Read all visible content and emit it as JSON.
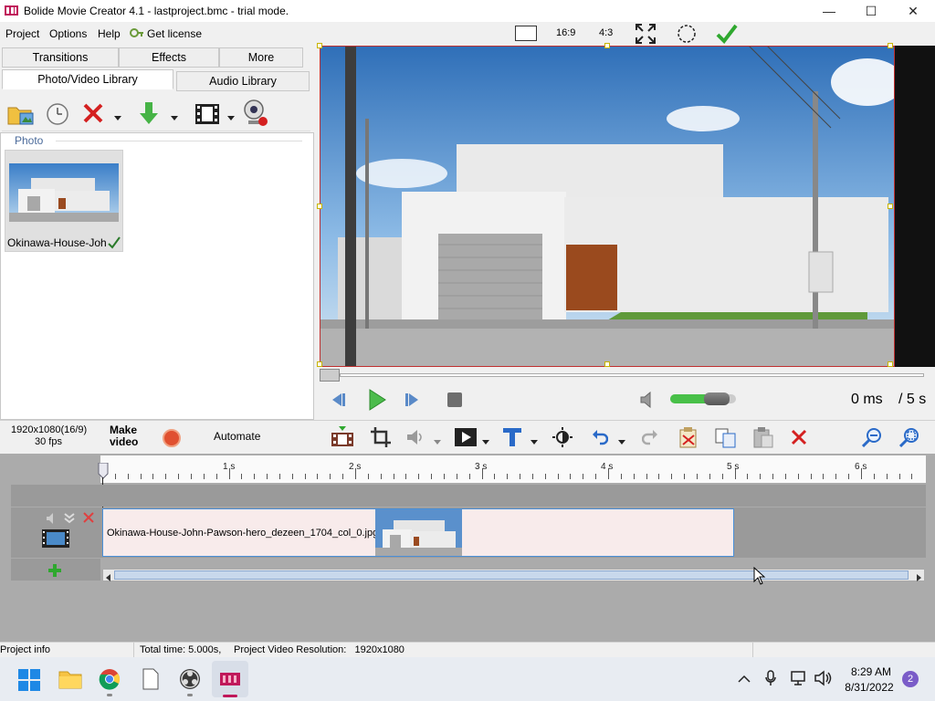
{
  "window": {
    "title": "Bolide Movie Creator 4.1 - lastproject.bmc  - trial mode.",
    "controls": [
      "—",
      "☐",
      "✕"
    ]
  },
  "menu": {
    "items": [
      "Project",
      "Options",
      "Help"
    ],
    "get_license": "Get license"
  },
  "aspect": {
    "ratio_169": "16:9",
    "ratio_43": "4:3"
  },
  "library": {
    "tabs_top": [
      "Transitions",
      "Effects",
      "More"
    ],
    "tabs_bottom": [
      "Photo/Video Library",
      "Audio Library"
    ],
    "section_label": "Photo",
    "item_name": "Okinawa-House-Joh"
  },
  "player": {
    "time_current": "0 ms",
    "time_total": "/ 5 s",
    "volume_level": 0.85
  },
  "project": {
    "resolution_label": "1920x1080(16/9)",
    "fps_label": "30 fps",
    "make_video_line1": "Make",
    "make_video_line2": "video",
    "automate": "Automate"
  },
  "timeline": {
    "ruler": [
      "1 s",
      "2 s",
      "3 s",
      "4 s",
      "5 s",
      "6 s"
    ],
    "clip_name": "Okinawa-House-John-Pawson-hero_dezeen_1704_col_0.jpg"
  },
  "status": {
    "project_info": "Project info",
    "total_time": "Total time: 5.000s,",
    "resolution": "Project Video Resolution:   1920x1080"
  },
  "taskbar": {
    "time": "8:29 AM",
    "date": "8/31/2022",
    "notification_count": "2"
  },
  "colors": {
    "accent_green": "#2fa82f",
    "selection_border": "#4a90d9",
    "clip_bg": "#f8ebeb",
    "record_red": "#e05030"
  }
}
